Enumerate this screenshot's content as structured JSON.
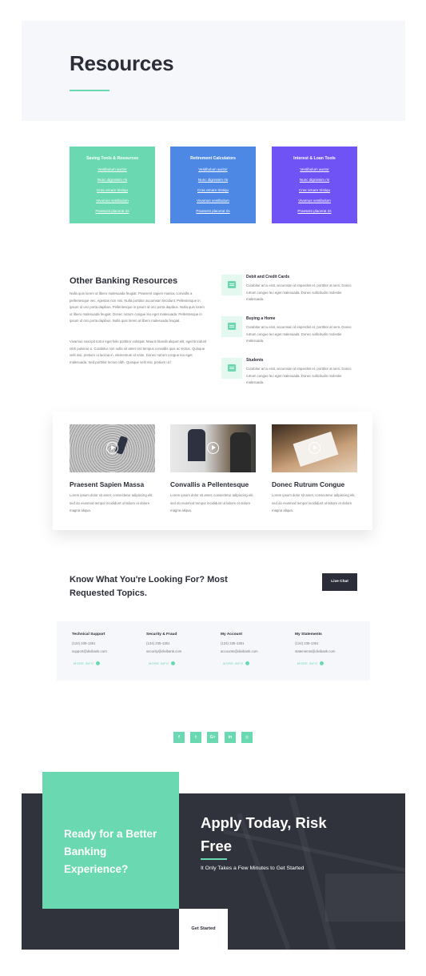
{
  "hero": {
    "title": "Resources"
  },
  "tools": [
    {
      "title": "Saving Tools & Resources",
      "color": "#6ad8b0",
      "links": [
        "Vestibulum auctor",
        "Nunc dignissim ris",
        "Cras ornare tristiqu",
        "Vivamus vestibulum",
        "Praesent placerat ris"
      ]
    },
    {
      "title": "Retirement Calculators",
      "color": "#4d88e4",
      "links": [
        "Vestibulum auctor",
        "Nunc dignissim ris",
        "Cras ornare tristiqu",
        "Vivamus vestibulum",
        "Praesent placerat ris"
      ]
    },
    {
      "title": "Interest & Loan Tools",
      "color": "#7053f5",
      "links": [
        "Vestibulum auctor",
        "Nunc dignissim ris",
        "Cras ornare tristiqu",
        "Vivamus vestibulum",
        "Praesent placerat ris"
      ]
    }
  ],
  "other_banking": {
    "title": "Other Banking Resources",
    "paragraphs": [
      "Nulla quis lorem ut libero malesuada feugiat. Praesent sapien massa, convallis a pellentesque nec, egestas non nisi. Nulla porttitor accumsan tincidunt. Pellentesque in ipsum id orci porta dapibus. Pellentesque in ipsum id orci porta dapibus. Nulla quis lorem ut libero malesuada feugiat. Donec rutrum congue leo eget malesuada. Pellentesque in ipsum id orci porta dapibus. Nulla quis lorem ut libero malesuada feugiat.",
      "Vivamus suscipit tortor eget felis porttitor volutpat. Mauris blandit aliquet elit, eget tincidunt nibh pulvinar a. Curabitur non nulla sit amet nisl tempus convallis quis ac lectus. Quisque velit nisi, pretium ut lacinia in, elementum id enim. Donec rutrum congue leo eget malesuada. Sed porttitor lectus nibh. Quisque velit nisi, pretium ut l"
    ],
    "features": [
      {
        "title": "Debit and Credit Cards",
        "text": "Curabitur arcu erat, accumsan id imperdiet et, porttitor at sem. Donec rutrum congue leo eget malesuada. Donec sollicitudin molestie malesuada."
      },
      {
        "title": "Buying a Home",
        "text": "Curabitur arcu erat, accumsan id imperdiet et, porttitor at sem. Donec rutrum congue leo eget malesuada. Donec sollicitudin molestie malesuada."
      },
      {
        "title": "Students",
        "text": "Curabitur arcu erat, accumsan id imperdiet et, porttitor at sem. Donec rutrum congue leo eget malesuada. Donec sollicitudin molestie malesuada."
      }
    ]
  },
  "media": [
    {
      "title": "Praesent Sapien Massa",
      "text": "Lorem ipsum dolor sit amet, consectetur adipiscing elit, sed do eiusmod tempor incididunt ut labore et dolore magna aliqua."
    },
    {
      "title": "Convallis a Pellentesque",
      "text": "Lorem ipsum dolor sit amet, consectetur adipiscing elit, sed do eiusmod tempor incididunt ut labore et dolore magna aliqua."
    },
    {
      "title": "Donec Rutrum Congue",
      "text": "Lorem ipsum dolor sit amet, consectetur adipiscing elit, sed do eiusmod tempor incididunt ut labore et dolore magna aliqua."
    }
  ],
  "requested": {
    "title": "Know What You're Looking For? Most Requested Topics.",
    "live_chat": "Live Chat"
  },
  "contacts": [
    {
      "title": "Technical Support",
      "phone": "(124) 235-1351",
      "email": "support@divibank.com",
      "more": "MORE INFO"
    },
    {
      "title": "Security & Fraud",
      "phone": "(124) 235-1351",
      "email": "security@divibank.com",
      "more": "MORE INFO"
    },
    {
      "title": "My Account",
      "phone": "(124) 235-1351",
      "email": "accounts@divibank.com",
      "more": "MORE INFO"
    },
    {
      "title": "My Statements",
      "phone": "(124) 235-1351",
      "email": "statements@divibank.com",
      "more": "MORE INFO"
    }
  ],
  "social": [
    {
      "icon": "facebook-icon",
      "glyph": "f"
    },
    {
      "icon": "twitter-icon",
      "glyph": "t"
    },
    {
      "icon": "google-plus-icon",
      "glyph": "G+"
    },
    {
      "icon": "linkedin-icon",
      "glyph": "in"
    },
    {
      "icon": "instagram-icon",
      "glyph": "◎"
    }
  ],
  "cta": {
    "left_text": "Ready for a Better Banking Experience?",
    "title": "Apply Today, Risk Free",
    "subtitle": "It Only Takes a Few Minutes to Get Started",
    "button": "Get Started"
  },
  "colors": {
    "accent": "#6ad8b0",
    "dark": "#2b2d38",
    "blue": "#4d88e4",
    "purple": "#7053f5"
  }
}
